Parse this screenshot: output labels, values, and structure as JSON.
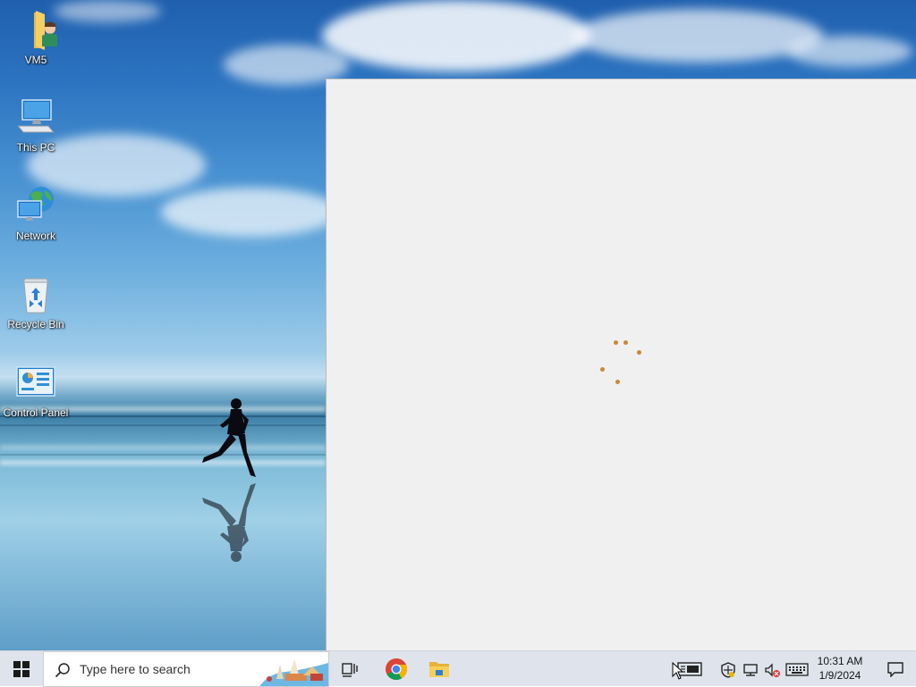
{
  "desktop": {
    "icons": [
      {
        "label": "VM5",
        "icon": "user-folder-icon"
      },
      {
        "label": "This PC",
        "icon": "computer-icon"
      },
      {
        "label": "Network",
        "icon": "network-icon"
      },
      {
        "label": "Recycle Bin",
        "icon": "recycle-bin-icon"
      },
      {
        "label": "Control Panel",
        "icon": "control-panel-icon"
      }
    ]
  },
  "window": {
    "state": "loading",
    "background": "#f0f0f0",
    "spinner_color": "#c8883a"
  },
  "taskbar": {
    "start_icon": "windows-logo-icon",
    "search": {
      "placeholder": "Type here to search"
    },
    "pinned": [
      {
        "name": "Task View",
        "icon": "task-view-icon"
      },
      {
        "name": "Google Chrome",
        "icon": "chrome-icon"
      },
      {
        "name": "File Explorer",
        "icon": "file-explorer-icon"
      }
    ],
    "tray": {
      "icons": [
        "news-icon",
        "security-icon",
        "network-tray-icon",
        "volume-muted-icon",
        "keyboard-icon"
      ],
      "time": "10:31 AM",
      "date": "1/9/2024"
    },
    "notification_icon": "action-center-icon"
  }
}
